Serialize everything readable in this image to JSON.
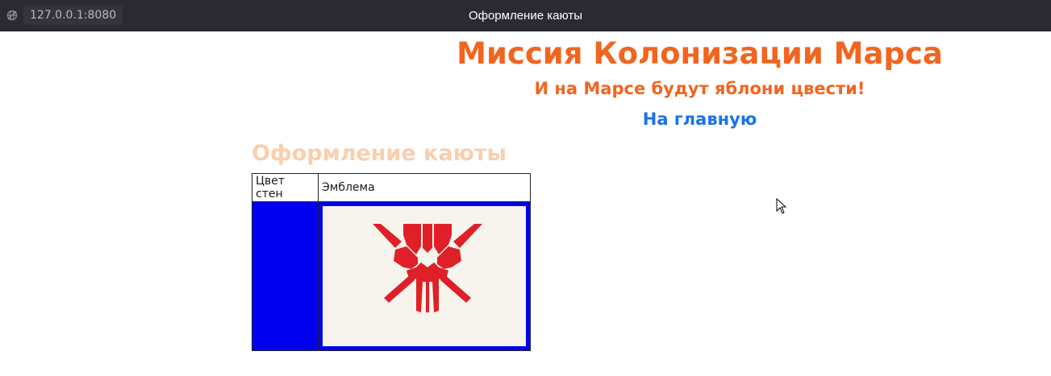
{
  "browser": {
    "url": "127.0.0.1:8080",
    "window_title": "Оформление каюты",
    "site_icon": "globe-slash-icon"
  },
  "header": {
    "title": "Миссия Колонизации Марса",
    "subtitle": "И на Марсе будут яблони цвести!",
    "home_link": "На главную"
  },
  "section": {
    "title": "Оформление каюты"
  },
  "table": {
    "headers": [
      "Цвет стен",
      "Эмблема"
    ],
    "wall_color": "#0000ee",
    "emblem_icon": "red-mask-emblem-icon",
    "emblem_color": "#e02028",
    "emblem_background": "#f6f4ec"
  },
  "colors": {
    "accent": "#f26520",
    "link": "#1a73e8",
    "section_title": "#f9cfae",
    "titlebar": "#2b2a33"
  }
}
